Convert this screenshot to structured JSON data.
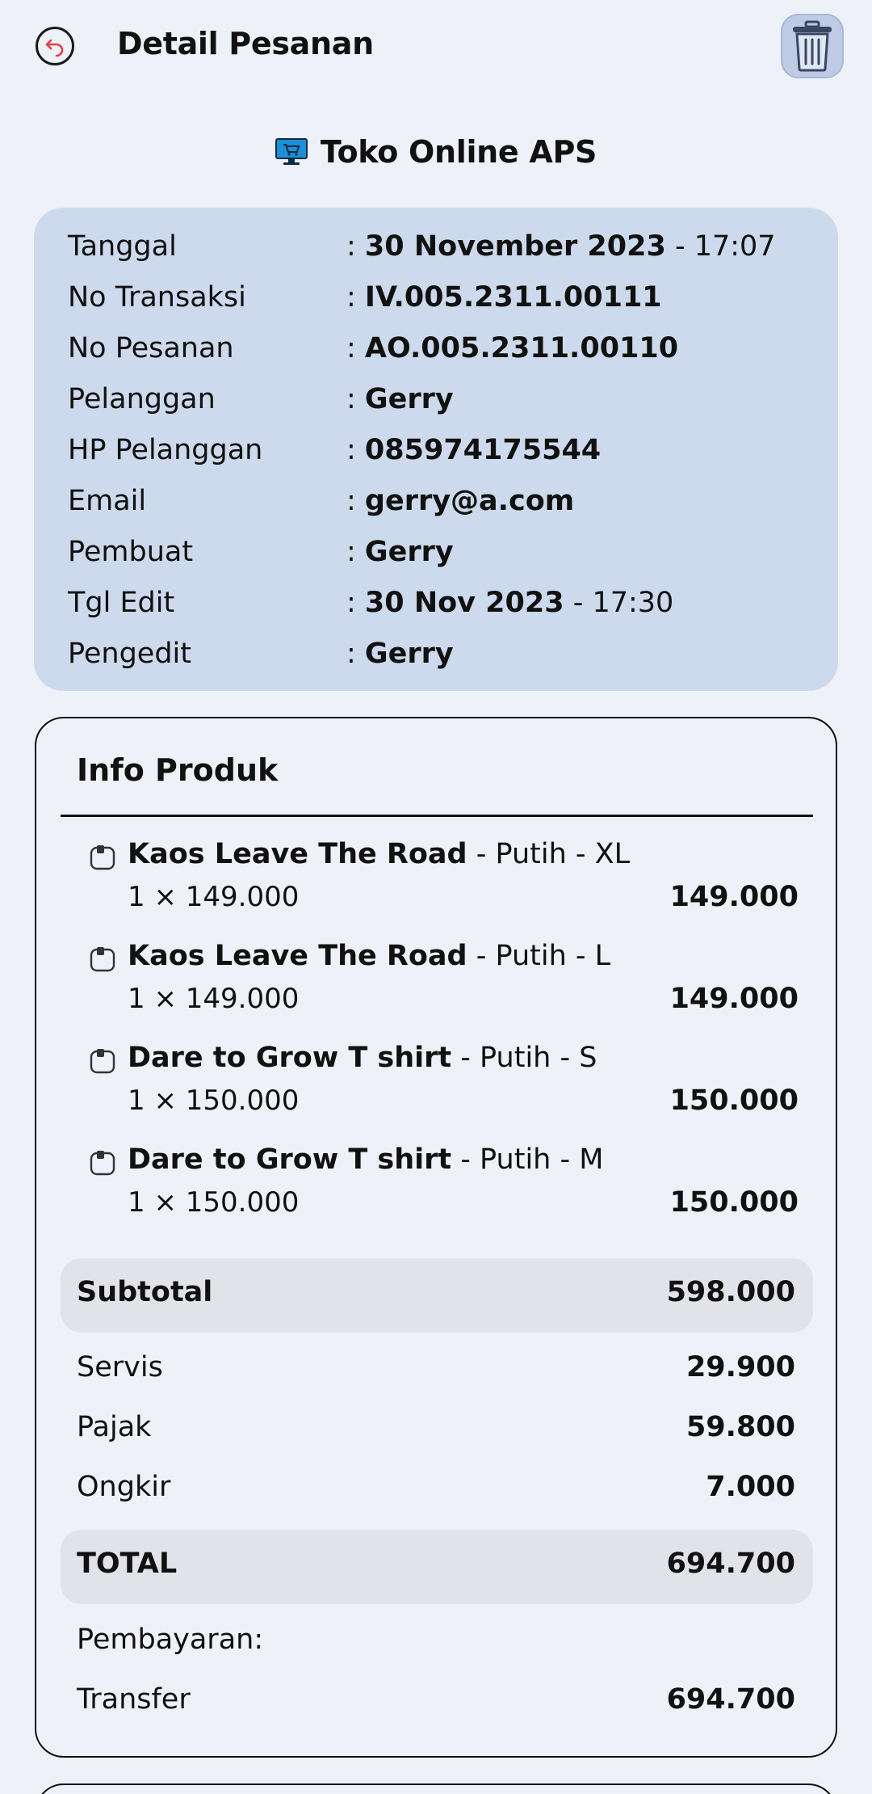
{
  "header": {
    "title": "Detail Pesanan",
    "back_icon": "undo-arrow-icon",
    "delete_icon": "trash-icon"
  },
  "store": {
    "icon": "computer-cart-icon",
    "name": "Toko Online APS"
  },
  "info": {
    "rows": [
      {
        "label": "Tanggal",
        "value_bold": "30 November 2023",
        "value_extra": " - 17:07"
      },
      {
        "label": "No Transaksi",
        "value_bold": "IV.005.2311.00111",
        "value_extra": ""
      },
      {
        "label": "No Pesanan",
        "value_bold": "AO.005.2311.00110",
        "value_extra": ""
      },
      {
        "label": "Pelanggan",
        "value_bold": "Gerry",
        "value_extra": ""
      },
      {
        "label": "HP Pelanggan",
        "value_bold": "085974175544",
        "value_extra": ""
      },
      {
        "label": "Email",
        "value_bold": "gerry@a.com",
        "value_extra": ""
      },
      {
        "label": "Pembuat",
        "value_bold": "Gerry",
        "value_extra": ""
      },
      {
        "label": "Tgl Edit",
        "value_bold": "30 Nov 2023",
        "value_extra": " - 17:30"
      },
      {
        "label": "Pengedit",
        "value_bold": "Gerry",
        "value_extra": ""
      }
    ],
    "separator": ": "
  },
  "products": {
    "title": "Info Produk",
    "items": [
      {
        "name": "Kaos Leave The Road",
        "variant": " - Putih - XL",
        "qty": "1 × 149.000",
        "total": "149.000"
      },
      {
        "name": "Kaos Leave The Road",
        "variant": " - Putih - L",
        "qty": "1 × 149.000",
        "total": "149.000"
      },
      {
        "name": "Dare to Grow T shirt",
        "variant": " - Putih - S",
        "qty": "1 × 150.000",
        "total": "150.000"
      },
      {
        "name": "Dare to Grow T shirt",
        "variant": " - Putih - M",
        "qty": "1 × 150.000",
        "total": "150.000"
      }
    ],
    "subtotal": {
      "label": "Subtotal",
      "value": "598.000"
    },
    "servis": {
      "label": "Servis",
      "value": "29.900"
    },
    "pajak": {
      "label": "Pajak",
      "value": "59.800"
    },
    "ongkir": {
      "label": "Ongkir",
      "value": "7.000"
    },
    "total": {
      "label": "TOTAL",
      "value": "694.700"
    },
    "payment_heading": "Pembayaran:",
    "payment": {
      "label": "Transfer",
      "value": "694.700"
    }
  },
  "colors": {
    "background": "#eff1f8",
    "info_box": "#cdd9ec",
    "band": "#e2e3e9",
    "back_arrow": "#e0404a",
    "trash_button": "#bfcbe5"
  }
}
